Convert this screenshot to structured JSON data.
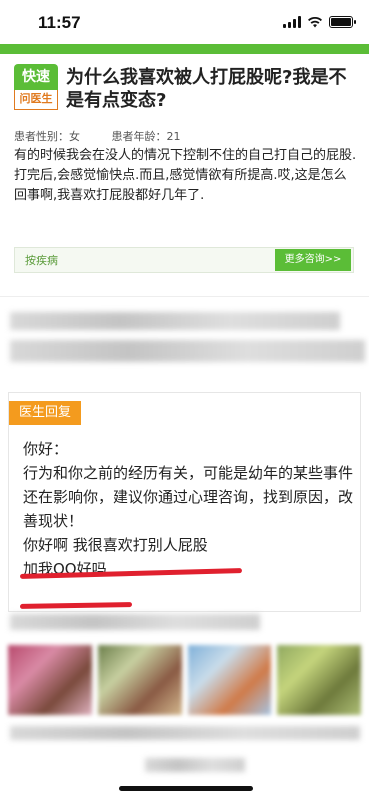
{
  "status_bar": {
    "time": "11:57"
  },
  "logo": {
    "top": "快速",
    "bottom": "问医生"
  },
  "question": {
    "title": "为什么我喜欢被人打屁股呢?我是不是有点变态?",
    "gender_label": "患者性别：女",
    "age_label": "患者年龄：21",
    "body": "有的时候我会在没人的情况下控制不住的自己打自己的屁股.打完后,会感觉愉快点.而且,感觉情欲有所提高.哎,这是怎么回事啊,我喜欢打屁股都好几年了."
  },
  "search_bar": {
    "label": "按疾病",
    "button": "更多咨询>>"
  },
  "reply": {
    "tag": "医生回复",
    "lines": [
      "你好：",
      "行为和你之前的经历有关，可能是幼年的某些事件还在影响你，建议你通过心理咨询，找到原因，改善现状！",
      "你好啊 我很喜欢打别人屁股",
      "加我QQ好吗"
    ]
  },
  "colors": {
    "brand_green": "#5bbd37",
    "reply_orange": "#f49b1e",
    "annotation_red": "#e0202e"
  }
}
